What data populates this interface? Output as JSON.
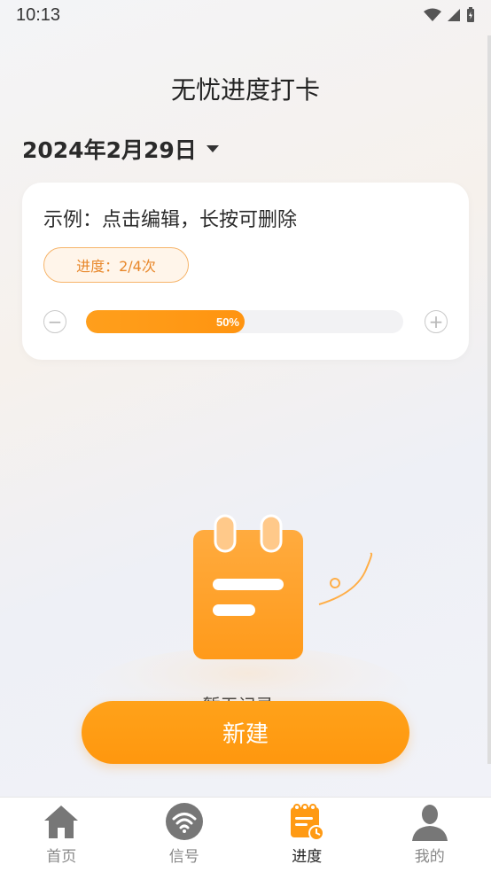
{
  "status_bar": {
    "time": "10:13"
  },
  "header": {
    "title": "无忧进度打卡"
  },
  "date_picker": {
    "date": "2024年2月29日"
  },
  "record_card": {
    "title": "示例：点击编辑，长按可删除",
    "progress_label": "进度：2/4次",
    "progress_fraction": 0.5,
    "progress_percent_text": "50%",
    "minus_symbol": "−",
    "plus_symbol": "+"
  },
  "empty_state": {
    "text": "暂无记录~"
  },
  "actions": {
    "new_label": "新建"
  },
  "colors": {
    "accent": "#FF9A14",
    "badge_bg": "#FFF5EA",
    "badge_border": "#F6B46A",
    "badge_text": "#E8872A"
  },
  "tabs": [
    {
      "label": "首页",
      "icon": "home-icon",
      "active": false
    },
    {
      "label": "信号",
      "icon": "wifi-signal-icon",
      "active": false
    },
    {
      "label": "进度",
      "icon": "calendar-clock-icon",
      "active": true
    },
    {
      "label": "我的",
      "icon": "user-icon",
      "active": false
    }
  ]
}
